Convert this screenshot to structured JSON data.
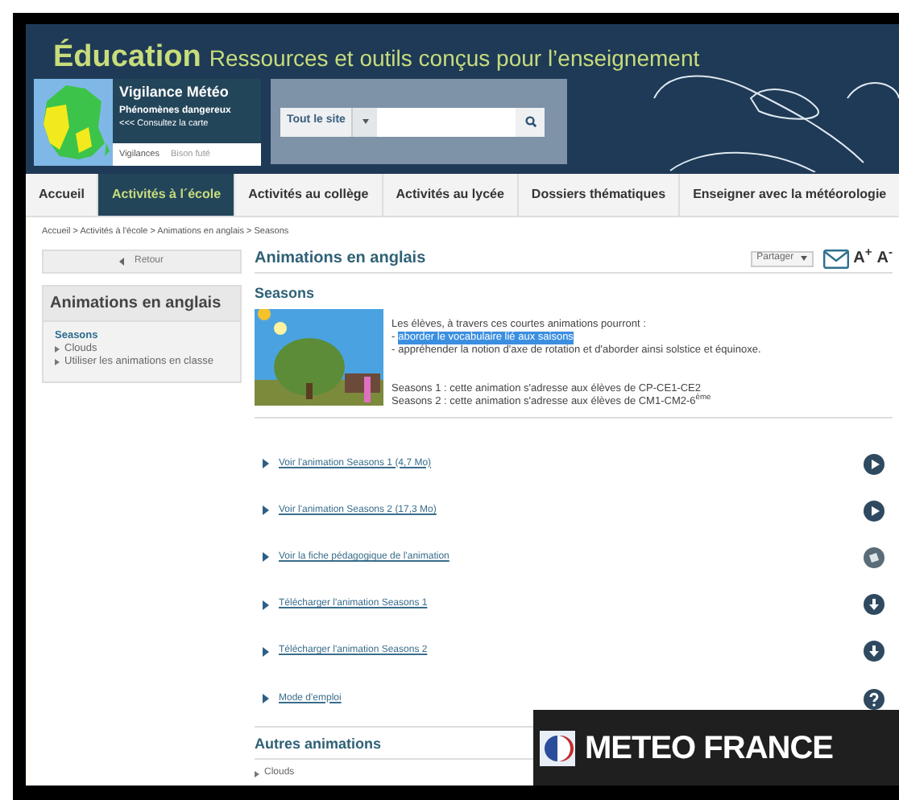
{
  "header": {
    "title": "Éducation",
    "subtitle": "Ressources et outils conçus pour l’enseignement"
  },
  "vigilance": {
    "title": "Vigilance Météo",
    "subtitle": "Phénomènes dangereux",
    "link": "<<< Consultez la carte",
    "tabs": [
      {
        "label": "Vigilances",
        "selected": true
      },
      {
        "label": "Bison futé",
        "selected": false
      }
    ]
  },
  "search": {
    "scope": "Tout le site"
  },
  "nav": [
    {
      "label": "Accueil",
      "selected": false
    },
    {
      "label": "Activités à l´école",
      "selected": true
    },
    {
      "label": "Activités au collège",
      "selected": false
    },
    {
      "label": "Activités au lycée",
      "selected": false
    },
    {
      "label": "Dossiers thématiques",
      "selected": false
    },
    {
      "label": "Enseigner avec la météorologie",
      "selected": false
    }
  ],
  "breadcrumb": "Accueil > Activités à l'école > Animations en anglais > Seasons",
  "back_button": "Retour",
  "sidebar": {
    "title": "Animations en anglais",
    "items": [
      {
        "label": "Seasons",
        "selected": true
      },
      {
        "label": "Clouds",
        "selected": false
      },
      {
        "label": "Utiliser les animations en classe",
        "selected": false
      }
    ]
  },
  "main": {
    "title": "Animations en anglais",
    "share": "Partager",
    "font_buttons": [
      "A$^{+}$",
      "A$^{-}$"
    ],
    "section_title": "Seasons",
    "intro": "Les élèves, à travers ces courtes animations pourront :",
    "goals": [
      {
        "prefix": "-",
        "text": "aborder le vocabulaire lié aux saisons",
        "highlighted": true
      },
      {
        "prefix": "-",
        "text": "appréhender la notion d'axe de rotation et d'aborder ainsi solstice et équinoxe.",
        "highlighted": false
      }
    ],
    "audiences": [
      "Seasons 1 : cette animation s'adresse aux élèves de CP-CE1-CE2",
      "Seasons 2 : cette animation s'adresse aux élèves de CM1-CM2-6$^{ème}$"
    ],
    "links": [
      {
        "label": "Voir l'animation Seasons 1 (4,7 Mo)",
        "kind": "play"
      },
      {
        "label": "Voir l'animation Seasons 2 (17,3 Mo)",
        "kind": "play"
      },
      {
        "label": "Voir la fiche pédagogique de l'animation",
        "kind": "document"
      },
      {
        "label": "Télécharger l'animation Seasons 1",
        "kind": "download"
      },
      {
        "label": "Télécharger l'animation Seasons 2",
        "kind": "download"
      },
      {
        "label": "Mode d'emploi",
        "kind": "help"
      }
    ],
    "other": {
      "title": "Autres animations",
      "items": [
        "Clouds"
      ]
    }
  },
  "overlay_logo": {
    "text": "METEO FRANCE"
  }
}
